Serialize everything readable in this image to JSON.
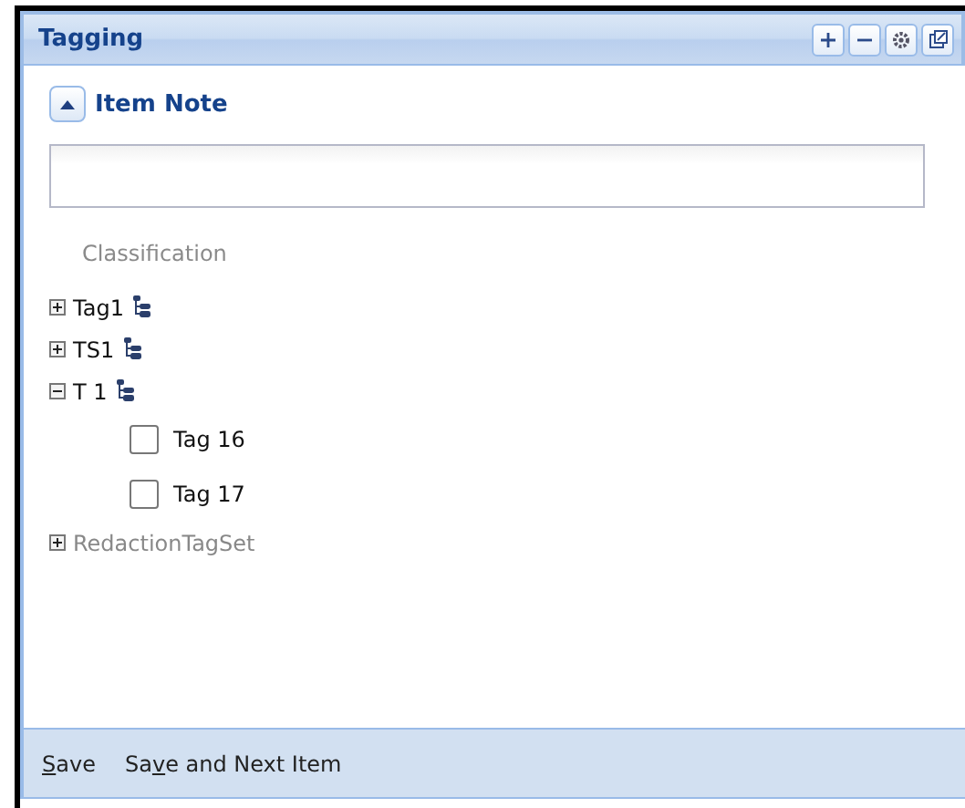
{
  "panel": {
    "title": "Tagging",
    "tools": [
      {
        "kind": "plus"
      },
      {
        "kind": "minus"
      },
      {
        "kind": "gear"
      },
      {
        "kind": "popout"
      }
    ]
  },
  "item_note": {
    "label": "Item Note",
    "expanded": true
  },
  "classification": {
    "label": "Classification"
  },
  "tree": [
    {
      "label": "Tag1",
      "kind": "tagset",
      "expanded": false,
      "disabled": false
    },
    {
      "label": "TS1",
      "kind": "tagset",
      "expanded": false,
      "disabled": false
    },
    {
      "label": "T 1",
      "kind": "tagset",
      "expanded": true,
      "disabled": false,
      "children": [
        {
          "label": "Tag 16",
          "kind": "checkbox",
          "checked": false
        },
        {
          "label": "Tag 17",
          "kind": "checkbox",
          "checked": false
        }
      ]
    },
    {
      "label": "RedactionTagSet",
      "kind": "plain",
      "expanded": false,
      "disabled": true
    }
  ],
  "footer": {
    "buttons": [
      {
        "key": "S",
        "after": "ave"
      },
      {
        "before": "Sa",
        "key": "v",
        "after": "e and Next Item"
      }
    ]
  }
}
